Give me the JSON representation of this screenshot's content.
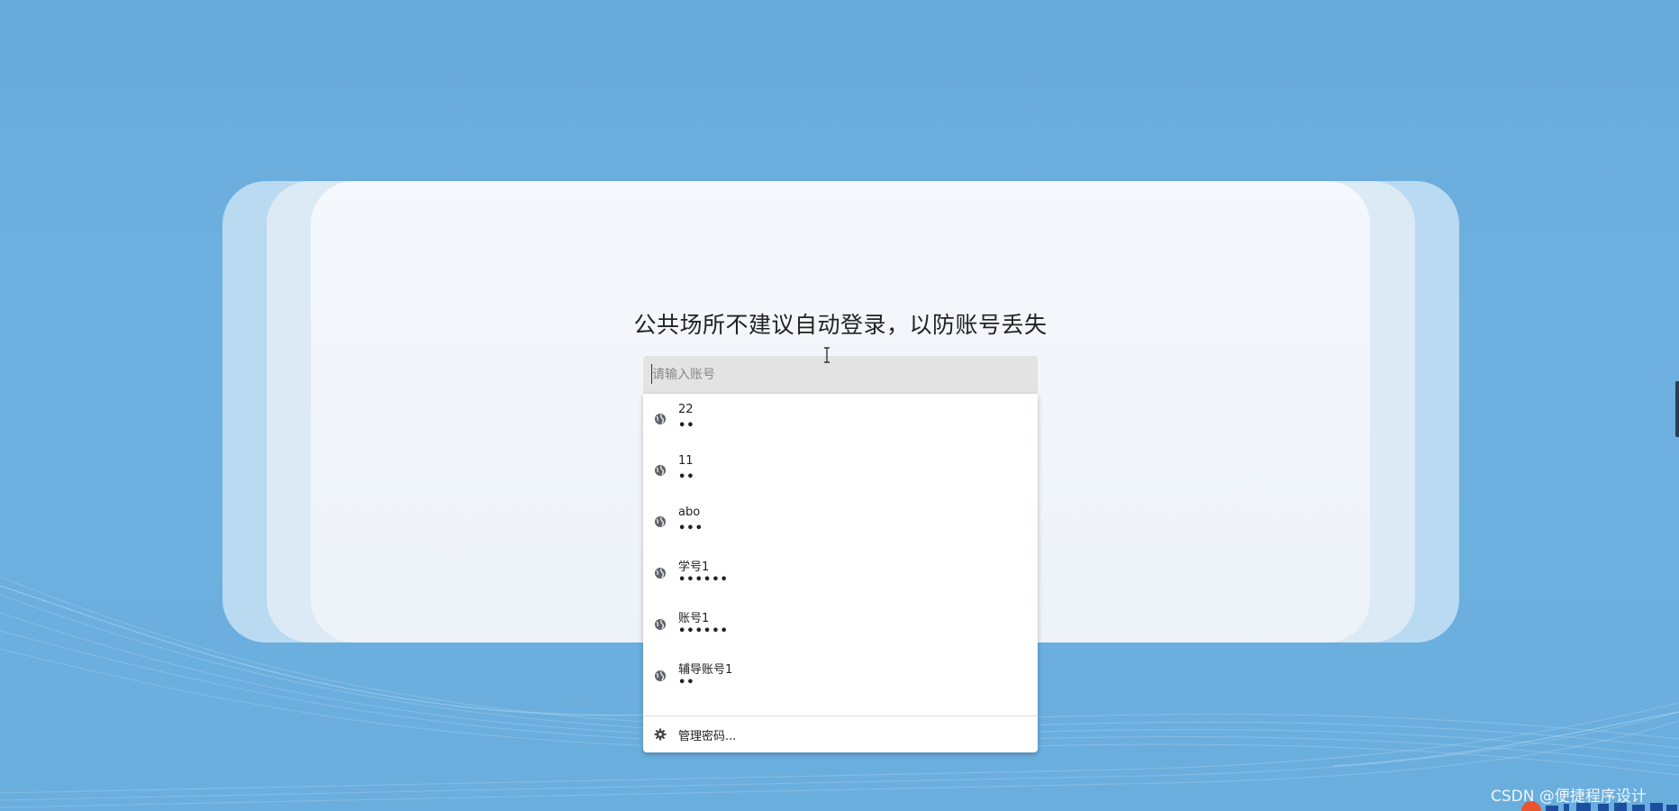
{
  "notice": "公共场所不建议自动登录，以防账号丢失",
  "account_input": {
    "placeholder": "请输入账号",
    "value": ""
  },
  "autofill": {
    "items": [
      {
        "username": "22",
        "password_mask": "••"
      },
      {
        "username": "11",
        "password_mask": "••"
      },
      {
        "username": "abo",
        "password_mask": "•••"
      },
      {
        "username": "学号1",
        "password_mask": "••••••"
      },
      {
        "username": "账号1",
        "password_mask": "••••••"
      },
      {
        "username": "辅导账号1",
        "password_mask": "••"
      }
    ],
    "manage_label": "管理密码..."
  },
  "watermark": "CSDN @便捷程序设计",
  "icons": {
    "credential": "globe-key-icon",
    "manage": "gear-icon",
    "cursor": "ibeam-cursor-icon"
  },
  "colors": {
    "background": "#6aaedd",
    "card": "#f2f6fb",
    "input": "#e3e3e3",
    "dropdown": "#ffffff"
  }
}
